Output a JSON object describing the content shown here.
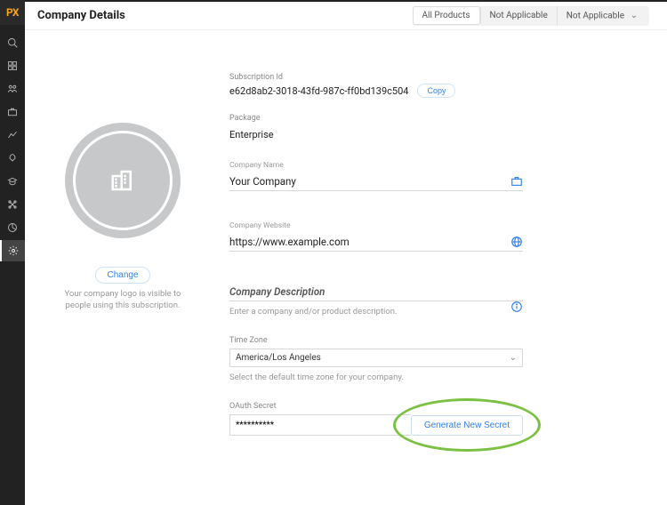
{
  "brand": "PX",
  "page_title": "Company Details",
  "header_tabs": {
    "all_products": "All Products",
    "na1": "Not Applicable",
    "na2": "Not Applicable"
  },
  "nav_icons": [
    "search",
    "dashboard",
    "users",
    "briefcase",
    "chart",
    "rocket",
    "education",
    "nodes",
    "pie",
    "settings"
  ],
  "subscription": {
    "label": "Subscription Id",
    "value": "e62d8ab2-3018-43fd-987c-ff0bd139c504",
    "copy": "Copy"
  },
  "package": {
    "label": "Package",
    "value": "Enterprise"
  },
  "logo": {
    "change": "Change",
    "hint": "Your company logo is visible to people using this subscription."
  },
  "fields": {
    "company_name": {
      "label": "Company Name",
      "value": "Your Company"
    },
    "company_website": {
      "label": "Company Website",
      "value": "https://www.example.com"
    },
    "company_description": {
      "placeholder": "Company Description",
      "hint": "Enter a company and/or product description."
    },
    "time_zone": {
      "label": "Time Zone",
      "selected": "America/Los Angeles",
      "hint": "Select the default time zone for your company."
    },
    "oauth": {
      "label": "OAuth Secret",
      "masked": "**********",
      "generate": "Generate New Secret"
    }
  }
}
